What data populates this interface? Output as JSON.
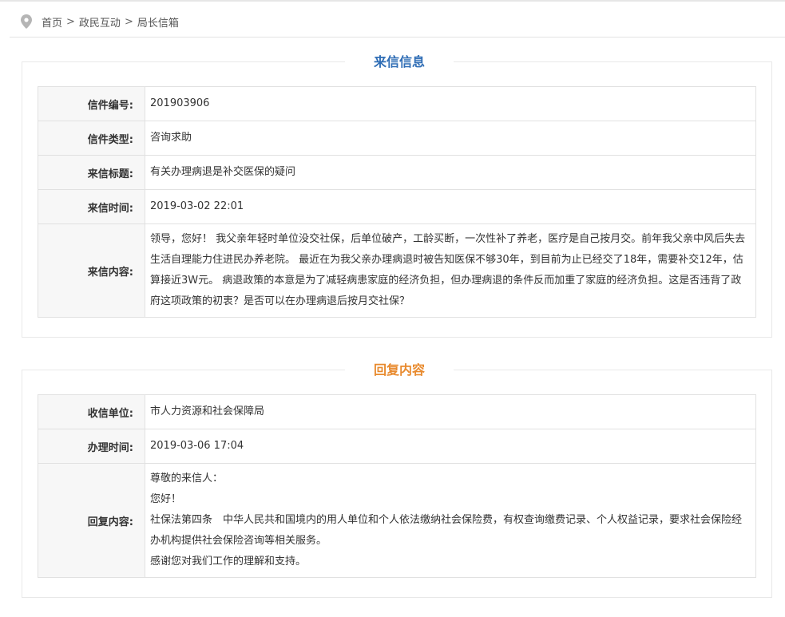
{
  "breadcrumb": {
    "icon": "location-pin-icon",
    "items": [
      "首页",
      "政民互动",
      "局长信箱"
    ],
    "separator": ">"
  },
  "letter": {
    "section_title": "来信信息",
    "title_color": "#2f6db5",
    "rows": [
      {
        "label": "信件编号:",
        "value": "201903906"
      },
      {
        "label": "信件类型:",
        "value": "咨询求助"
      },
      {
        "label": "来信标题:",
        "value": "有关办理病退是补交医保的疑问"
      },
      {
        "label": "来信时间:",
        "value": "2019-03-02 22:01"
      },
      {
        "label": "来信内容:",
        "value": "领导，您好！ 我父亲年轻时单位没交社保，后单位破产，工龄买断，一次性补了养老，医疗是自己按月交。前年我父亲中风后失去生活自理能力住进民办养老院。 最近在为我父亲办理病退时被告知医保不够30年，到目前为止已经交了18年，需要补交12年，估算接近3W元。 病退政策的本意是为了减轻病患家庭的经济负担，但办理病退的条件反而加重了家庭的经济负担。这是否违背了政府这项政策的初衷？是否可以在办理病退后按月交社保？"
      }
    ]
  },
  "reply": {
    "section_title": "回复内容",
    "title_color": "#e88a2e",
    "rows": [
      {
        "label": "收信单位:",
        "value": "市人力资源和社会保障局"
      },
      {
        "label": "办理时间:",
        "value": "2019-03-06 17:04"
      }
    ],
    "content_label": "回复内容:",
    "content_lines": [
      "尊敬的来信人：",
      "您好！",
      "社保法第四条　中华人民共和国境内的用人单位和个人依法缴纳社会保险费，有权查询缴费记录、个人权益记录，要求社会保险经办机构提供社会保险咨询等相关服务。",
      "感谢您对我们工作的理解和支持。"
    ]
  }
}
